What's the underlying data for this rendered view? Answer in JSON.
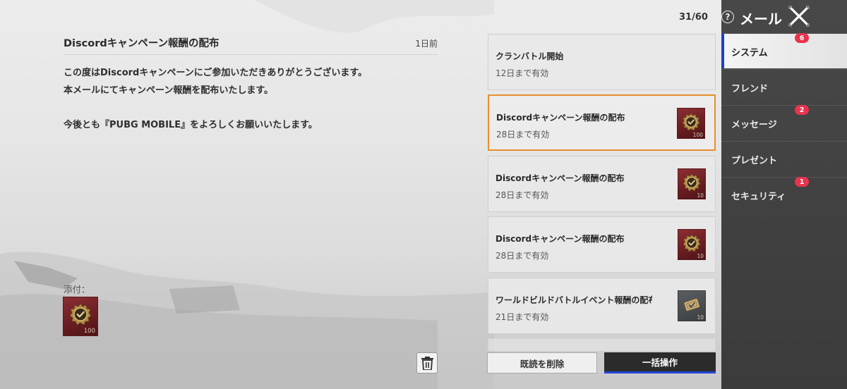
{
  "detail": {
    "title": "Discordキャンペーン報酬の配布",
    "time_ago": "1日前",
    "body": [
      "この度はDiscordキャンペーンにご参加いただきありがとうございます。",
      "本メールにてキャンペーン報酬を配布いたします。",
      "今後とも『PUBG MOBILE』をよろしくお願いいたします。"
    ],
    "attachment_label": "添付：",
    "attachment_qty": "100"
  },
  "list": {
    "counter": "31/60",
    "mails": [
      {
        "subject": "クランバトル開始",
        "expiry": "12日まで有効",
        "icon": "none"
      },
      {
        "subject": "Discordキャンペーン報酬の配布",
        "expiry": "28日まで有効",
        "icon": "medal-icon",
        "qty": "100",
        "selected": true
      },
      {
        "subject": "Discordキャンペーン報酬の配布",
        "expiry": "28日まで有効",
        "icon": "medal-icon",
        "qty": "10"
      },
      {
        "subject": "Discordキャンペーン報酬の配布",
        "expiry": "28日まで有効",
        "icon": "medal-icon",
        "qty": "10"
      },
      {
        "subject": "ワールドビルドバトルイベント報酬の配布",
        "expiry": "21日まで有効",
        "icon": "ticket-icon",
        "qty": "10"
      }
    ],
    "delete_read_label": "既読を削除",
    "bulk_action_label": "一括操作"
  },
  "nav": {
    "title": "メール",
    "help": "?",
    "items": [
      {
        "label": "システム",
        "badge": "6",
        "active": true
      },
      {
        "label": "フレンド",
        "badge": ""
      },
      {
        "label": "メッセージ",
        "badge": "2"
      },
      {
        "label": "プレゼント",
        "badge": ""
      },
      {
        "label": "セキュリティ",
        "badge": "1"
      }
    ]
  },
  "colors": {
    "selected_border": "#e78f2d",
    "badge": "#e8334f",
    "active_accent": "#1a3fd0",
    "medal_bg": "#7a2429"
  }
}
